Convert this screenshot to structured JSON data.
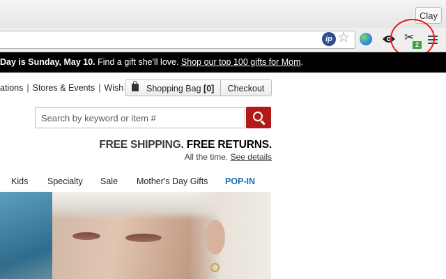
{
  "browser": {
    "user_label": "Clay",
    "badge_count": "2",
    "ip_icon_text": "ip",
    "icons": [
      "ip-extension-icon",
      "star-icon",
      "globe-icon",
      "eye-icon",
      "scissors-icon",
      "menu-icon"
    ],
    "annotation_color": "#e31b1b"
  },
  "promo": {
    "pre": "Day is Sunday, May 10.",
    "mid": " Find a gift she'll love. ",
    "link": "Shop our top 100 gifts for Mom",
    "post": "."
  },
  "utility": {
    "links": [
      "ations",
      "Stores & Events",
      "Wish List"
    ],
    "bag_label": "Shopping Bag",
    "bag_count": "[0]",
    "checkout_label": "Checkout"
  },
  "search": {
    "placeholder": "Search by keyword or item #",
    "button_color": "#b01a1a"
  },
  "shipping": {
    "line1a": "FREE SHIPPING.",
    "line1b": "FREE RETURNS.",
    "line2": "All the time.",
    "link": "See details"
  },
  "nav": {
    "items": [
      "Kids",
      "Specialty",
      "Sale",
      "Mother's Day Gifts",
      "POP-IN"
    ],
    "accent": "#1a6fb3"
  }
}
